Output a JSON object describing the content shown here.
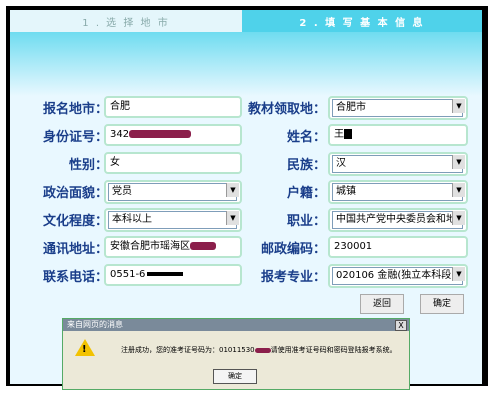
{
  "steps": {
    "step1": "1 . 选 择 地 市",
    "step2": "2 . 填 写 基 本 信 息"
  },
  "form": {
    "baoming_label": "报名地市：",
    "baoming_value": "合肥",
    "jiaocai_label": "教材领取地：",
    "jiaocai_value": "合肥市",
    "sfz_label": "身份证号：",
    "sfz_value": "342",
    "name_label": "姓名：",
    "name_value": "王",
    "gender_label": "性别：",
    "gender_value": "女",
    "nation_label": "民族：",
    "nation_value": "汉",
    "politics_label": "政治面貌：",
    "politics_value": "党员",
    "huji_label": "户籍：",
    "huji_value": "城镇",
    "edu_label": "文化程度：",
    "edu_value": "本科以上",
    "job_label": "职业：",
    "job_value": "中国共产党中央委员会和地方",
    "addr_label": "通讯地址：",
    "addr_value": "安徽合肥市瑶海区",
    "post_label": "邮政编码：",
    "post_value": "230001",
    "phone_label": "联系电话：",
    "phone_value": "0551-6",
    "major_label": "报考专业：",
    "major_value": "020106 金融(独立本科段)"
  },
  "buttons": {
    "back": "返回",
    "confirm": "确定"
  },
  "dialog": {
    "title": "来自网页的消息",
    "close": "X",
    "message_pre": "注册成功，您的准考证号码为：01011530",
    "message_post": "请使用准考证号码和密码登陆报考系统。",
    "ok": "确定"
  }
}
